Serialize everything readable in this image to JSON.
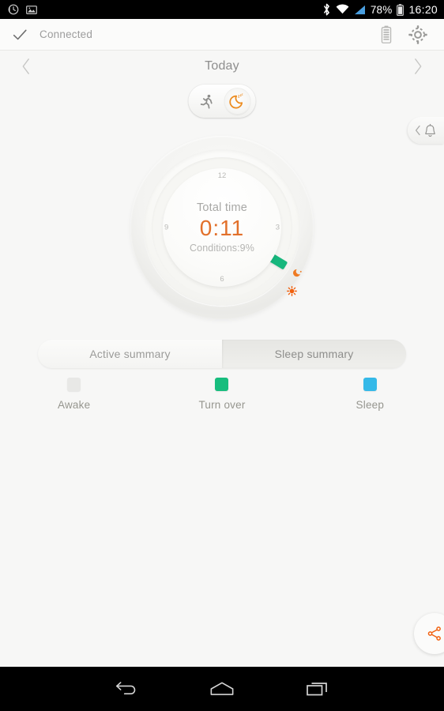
{
  "status_bar": {
    "notification_icons": [
      "alarm-clock-icon",
      "screenshot-image-icon"
    ],
    "bluetooth_icon": "bluetooth-icon",
    "wifi_icon": "wifi-icon",
    "signal_icon": "cellular-signal-icon",
    "battery_percent": "78%",
    "battery_icon": "battery-icon",
    "time": "16:20"
  },
  "app_bar": {
    "check_icon": "check-icon",
    "connection_status": "Connected",
    "device_battery_icon": "device-battery-icon",
    "settings_icon": "gear-icon"
  },
  "date_nav": {
    "prev_icon": "chevron-left-icon",
    "title": "Today",
    "next_icon": "chevron-right-icon"
  },
  "mode_toggle": {
    "active_mode": "sleep",
    "modes": [
      {
        "id": "activity",
        "icon": "running-person-icon",
        "active": false
      },
      {
        "id": "sleep",
        "icon": "moon-zzz-icon",
        "active": true
      }
    ]
  },
  "alarm_tab": {
    "expand_icon": "chevron-left-icon",
    "bell_icon": "bell-icon"
  },
  "dial": {
    "label": "Total time",
    "value": "0:11",
    "conditions": "Conditions:9%",
    "value_color": "#e2702a",
    "ticks": [
      "12",
      "3",
      "6",
      "9"
    ],
    "segment_color": "#17b77d",
    "sleep_marker_icon": "moon-icon",
    "wake_marker_icon": "sun-icon"
  },
  "summary_tabs": {
    "active_index": 1,
    "items": [
      {
        "label": "Active summary"
      },
      {
        "label": "Sleep summary"
      }
    ]
  },
  "legend": {
    "items": [
      {
        "label": "Awake",
        "color": "#e8e8e6"
      },
      {
        "label": "Turn over",
        "color": "#18bd7e"
      },
      {
        "label": "Sleep",
        "color": "#35b9e8"
      }
    ]
  },
  "share_fab": {
    "icon": "share-icon",
    "color": "#f2600e"
  },
  "nav_bar": {
    "back_icon": "back-arrow-icon",
    "home_icon": "home-icon",
    "recents_icon": "recent-apps-icon"
  }
}
